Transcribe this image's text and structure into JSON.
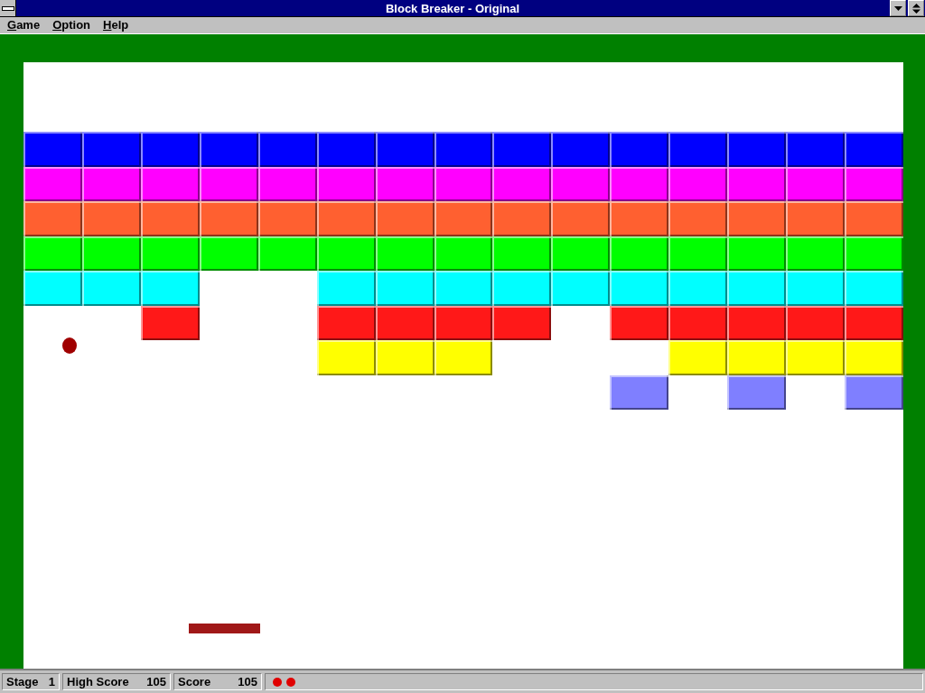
{
  "window": {
    "title": "Block Breaker - Original"
  },
  "menu": [
    "Game",
    "Option",
    "Help"
  ],
  "brick_rows": [
    {
      "color": "#0000ff",
      "cells": [
        {
          "kind": "brick"
        },
        {
          "kind": "brick"
        },
        {
          "kind": "brick"
        },
        {
          "kind": "brick"
        },
        {
          "kind": "brick"
        },
        {
          "kind": "brick"
        },
        {
          "kind": "brick"
        },
        {
          "kind": "brick"
        },
        {
          "kind": "brick"
        },
        {
          "kind": "brick"
        },
        {
          "kind": "brick"
        },
        {
          "kind": "brick"
        },
        {
          "kind": "brick"
        },
        {
          "kind": "brick"
        },
        {
          "kind": "brick"
        }
      ]
    },
    {
      "color": "#ff00ff",
      "cells": [
        {
          "kind": "brick"
        },
        {
          "kind": "brick"
        },
        {
          "kind": "brick"
        },
        {
          "kind": "brick"
        },
        {
          "kind": "brick"
        },
        {
          "kind": "brick"
        },
        {
          "kind": "brick"
        },
        {
          "kind": "brick"
        },
        {
          "kind": "brick"
        },
        {
          "kind": "brick"
        },
        {
          "kind": "brick"
        },
        {
          "kind": "brick"
        },
        {
          "kind": "brick"
        },
        {
          "kind": "brick"
        },
        {
          "kind": "brick"
        }
      ]
    },
    {
      "color": "#ff6030",
      "cells": [
        {
          "kind": "brick"
        },
        {
          "kind": "brick"
        },
        {
          "kind": "brick"
        },
        {
          "kind": "brick"
        },
        {
          "kind": "brick"
        },
        {
          "kind": "brick"
        },
        {
          "kind": "brick"
        },
        {
          "kind": "brick"
        },
        {
          "kind": "brick"
        },
        {
          "kind": "brick"
        },
        {
          "kind": "brick"
        },
        {
          "kind": "brick"
        },
        {
          "kind": "brick"
        },
        {
          "kind": "brick"
        },
        {
          "kind": "brick"
        }
      ]
    },
    {
      "color": "#00ff00",
      "cells": [
        {
          "kind": "brick"
        },
        {
          "kind": "brick"
        },
        {
          "kind": "brick"
        },
        {
          "kind": "brick"
        },
        {
          "kind": "brick"
        },
        {
          "kind": "brick"
        },
        {
          "kind": "brick"
        },
        {
          "kind": "brick"
        },
        {
          "kind": "brick"
        },
        {
          "kind": "brick"
        },
        {
          "kind": "brick"
        },
        {
          "kind": "brick"
        },
        {
          "kind": "brick"
        },
        {
          "kind": "brick"
        },
        {
          "kind": "brick"
        }
      ]
    },
    {
      "color": "#00ffff",
      "cells": [
        {
          "kind": "brick"
        },
        {
          "kind": "brick"
        },
        {
          "kind": "brick"
        },
        {
          "kind": "gap"
        },
        {
          "kind": "gap"
        },
        {
          "kind": "brick"
        },
        {
          "kind": "brick"
        },
        {
          "kind": "brick"
        },
        {
          "kind": "brick"
        },
        {
          "kind": "brick"
        },
        {
          "kind": "brick"
        },
        {
          "kind": "brick"
        },
        {
          "kind": "brick"
        },
        {
          "kind": "brick"
        },
        {
          "kind": "brick"
        }
      ]
    },
    {
      "color": "#ff1818",
      "cells": [
        {
          "kind": "gap"
        },
        {
          "kind": "gap"
        },
        {
          "kind": "brick"
        },
        {
          "kind": "gap"
        },
        {
          "kind": "gap"
        },
        {
          "kind": "brick"
        },
        {
          "kind": "brick"
        },
        {
          "kind": "brick"
        },
        {
          "kind": "brick"
        },
        {
          "kind": "gap"
        },
        {
          "kind": "brick"
        },
        {
          "kind": "brick"
        },
        {
          "kind": "brick"
        },
        {
          "kind": "brick"
        },
        {
          "kind": "brick"
        }
      ]
    },
    {
      "color": "#ffff00",
      "cells": [
        {
          "kind": "gap"
        },
        {
          "kind": "gap"
        },
        {
          "kind": "gap"
        },
        {
          "kind": "gap"
        },
        {
          "kind": "gap"
        },
        {
          "kind": "brick"
        },
        {
          "kind": "brick"
        },
        {
          "kind": "brick"
        },
        {
          "kind": "gap"
        },
        {
          "kind": "gap"
        },
        {
          "kind": "gap"
        },
        {
          "kind": "brick"
        },
        {
          "kind": "brick"
        },
        {
          "kind": "brick"
        },
        {
          "kind": "brick"
        }
      ]
    },
    {
      "color": "#7f7fff",
      "cells": [
        {
          "kind": "gap"
        },
        {
          "kind": "gap"
        },
        {
          "kind": "gap"
        },
        {
          "kind": "gap"
        },
        {
          "kind": "gap"
        },
        {
          "kind": "gap"
        },
        {
          "kind": "gap"
        },
        {
          "kind": "gap"
        },
        {
          "kind": "gap"
        },
        {
          "kind": "gap"
        },
        {
          "kind": "brick"
        },
        {
          "kind": "gap"
        },
        {
          "kind": "brick"
        },
        {
          "kind": "gap"
        },
        {
          "kind": "brick"
        }
      ]
    }
  ],
  "status_bar": {
    "stage_label": "Stage",
    "stage": "1",
    "high_score_label": "High Score",
    "high_score": "105",
    "score_label": "Score",
    "score": "105",
    "lives": [
      {
        "kind": "ball"
      },
      {
        "kind": "ball"
      }
    ]
  }
}
